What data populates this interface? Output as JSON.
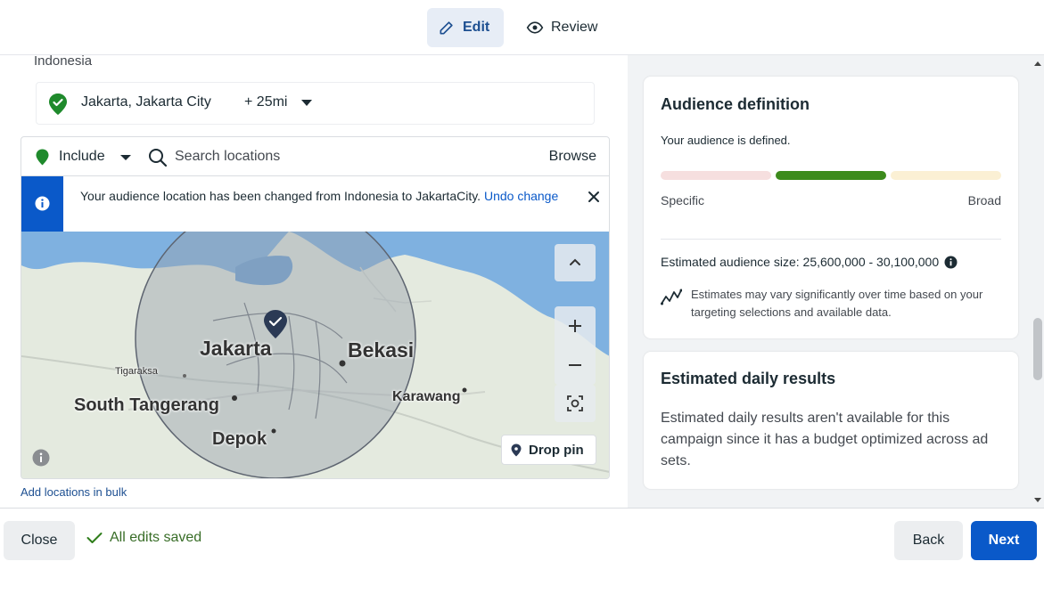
{
  "colors": {
    "accent_blue": "#0a59c9",
    "success_green": "#2e7d1a",
    "meter_specific": "#f6dfdf",
    "meter_active": "#3c8b1c",
    "meter_broad": "#fbf0d4"
  },
  "header": {
    "edit_label": "Edit",
    "edit_icon": "pencil-icon",
    "review_label": "Review",
    "review_icon": "eye-icon",
    "active_tab": "Edit"
  },
  "location": {
    "country": "Indonesia",
    "selected_name": "Jakarta, Jakarta City",
    "radius": "+ 25mi",
    "include_label": "Include",
    "search_placeholder": "Search locations",
    "browse_label": "Browse",
    "notice_text": "Your audience location has been changed from Indonesia to JakartaCity.",
    "notice_link": "Undo change",
    "bulk_link": "Add locations in bulk"
  },
  "map": {
    "labels": [
      "Jakarta",
      "Bekasi",
      "Tigaraksa",
      "South Tangerang",
      "Karawang",
      "Depok"
    ],
    "drop_pin_label": "Drop pin"
  },
  "audience_definition": {
    "title": "Audience definition",
    "status": "Your audience is defined.",
    "meter_level": "middle of 3 segments",
    "label_specific": "Specific",
    "label_broad": "Broad",
    "size_text": "Estimated audience size: 25,600,000 - 30,100,000",
    "vary_note": "Estimates may vary significantly over time based on your targeting selections and available data."
  },
  "daily_results": {
    "title": "Estimated daily results",
    "text": "Estimated daily results aren't available for this campaign since it has a budget optimized across ad sets."
  },
  "footer": {
    "close_label": "Close",
    "saved_label": "All edits saved",
    "back_label": "Back",
    "next_label": "Next"
  }
}
